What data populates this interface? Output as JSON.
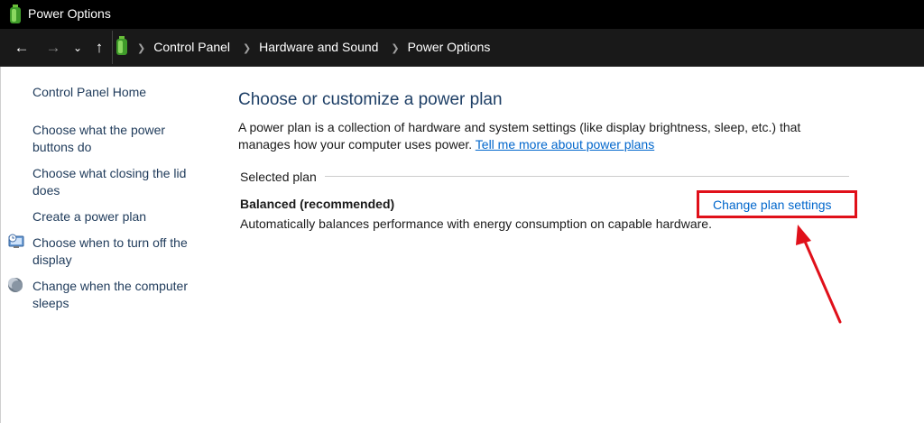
{
  "window": {
    "title": "Power Options"
  },
  "address_bar": {
    "back_icon": "arrow-left-icon",
    "forward_icon": "arrow-right-icon",
    "recent_icon": "chevron-down-icon",
    "up_icon": "arrow-up-icon",
    "breadcrumbs": [
      "Control Panel",
      "Hardware and Sound",
      "Power Options"
    ]
  },
  "sidebar": {
    "home": "Control Panel Home",
    "items": [
      {
        "label_line1": "Choose what the power",
        "label_line2": "buttons do"
      },
      {
        "label_line1": "Choose what closing the lid",
        "label_line2": "does"
      },
      {
        "label_line1": "Create a power plan"
      },
      {
        "label_line1": "Choose when to turn off the",
        "label_line2": "display",
        "icon": "display-clock-icon"
      },
      {
        "label_line1": "Change when the computer",
        "label_line2": "sleeps",
        "icon": "moon-icon"
      }
    ]
  },
  "main": {
    "title": "Choose or customize a power plan",
    "description": "A power plan is a collection of hardware and system settings (like display brightness, sleep, etc.) that manages how your computer uses power.",
    "learn_more_link": "Tell me more about power plans",
    "selected_plan_label": "Selected plan",
    "plan": {
      "name": "Balanced (recommended)",
      "description": "Automatically balances performance with energy consumption on capable hardware.",
      "change_link": "Change plan settings"
    }
  },
  "annotation": {
    "highlight_color": "#e0101a"
  },
  "colors": {
    "title_blue": "#1e3f66",
    "link_blue": "#0066cc",
    "sidebar_text": "#1e3a5a"
  }
}
